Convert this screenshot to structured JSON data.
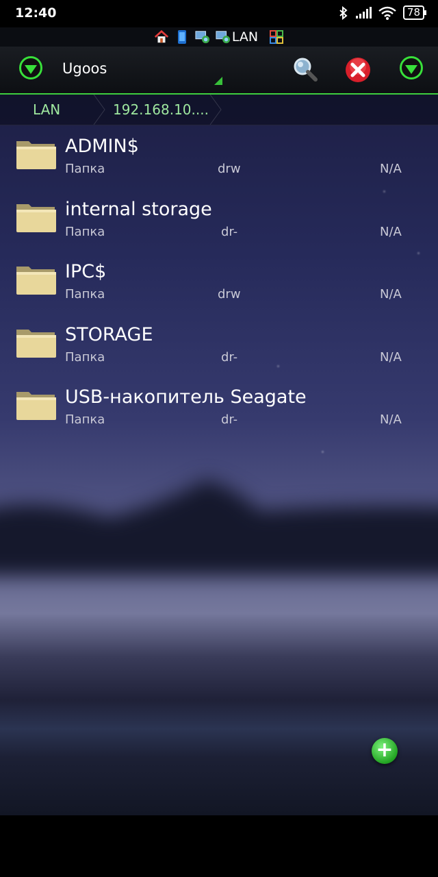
{
  "status_bar": {
    "time": "12:40",
    "battery": "78"
  },
  "tabs": {
    "label": "LAN"
  },
  "toolbar": {
    "location": "Ugoos"
  },
  "path": {
    "crumbs": [
      "LAN",
      "192.168.10...."
    ]
  },
  "files": [
    {
      "name": "ADMIN$",
      "type": "Папка",
      "perm": "drw",
      "size": "N/A"
    },
    {
      "name": "internal storage",
      "type": "Папка",
      "perm": "dr-",
      "size": "N/A"
    },
    {
      "name": "IPC$",
      "type": "Папка",
      "perm": "drw",
      "size": "N/A"
    },
    {
      "name": "STORAGE",
      "type": "Папка",
      "perm": "dr-",
      "size": "N/A"
    },
    {
      "name": "USB-накопитель Seagate",
      "type": "Папка",
      "perm": "dr-",
      "size": "N/A"
    }
  ]
}
